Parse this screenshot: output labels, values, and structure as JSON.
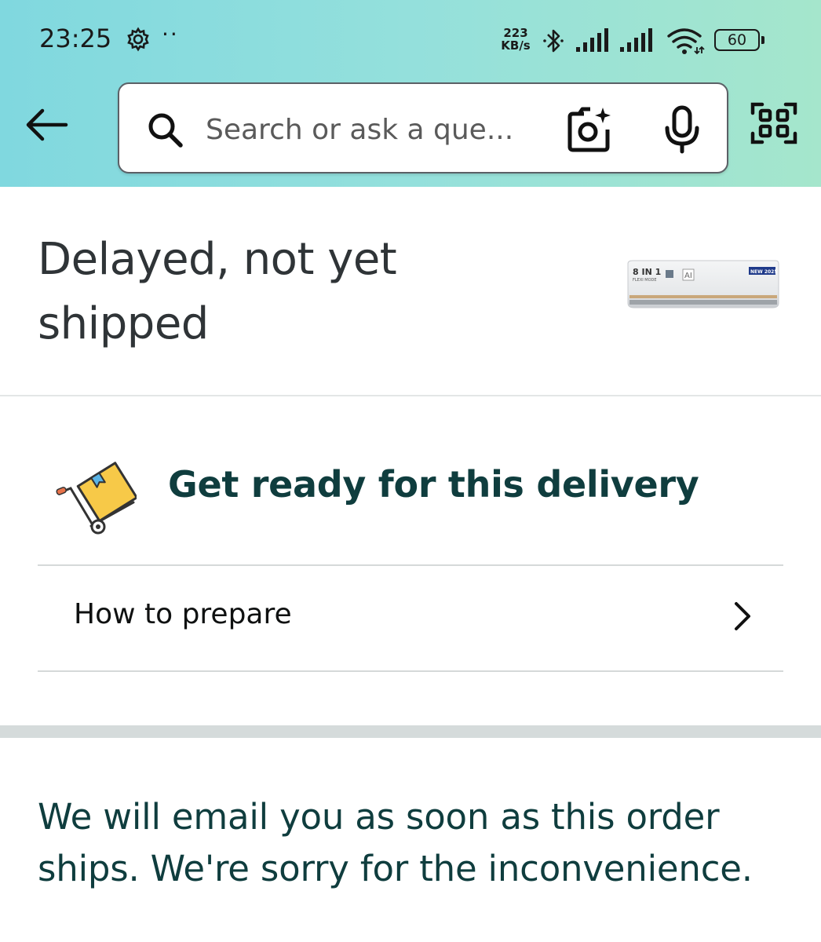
{
  "status_bar": {
    "time": "23:25",
    "dots": "··",
    "net_speed_value": "223",
    "net_speed_unit": "KB/s",
    "battery": "60"
  },
  "search": {
    "placeholder": "Search or ask a que..."
  },
  "order": {
    "status_title": "Delayed, not yet shipped",
    "product_image_text": [
      "8 IN 1",
      "FLEXI MODE",
      "AI",
      "NEW 2025"
    ]
  },
  "delivery": {
    "heading": "Get ready for this delivery",
    "prepare_label": "How to prepare"
  },
  "message": {
    "text": "We will email you as soon as this order ships. We're sorry for the inconvenience."
  },
  "colors": {
    "header_gradient_start": "#80d8df",
    "header_gradient_end": "#a5e6cc",
    "heading_teal": "#0f3d3e",
    "box_yellow": "#f7c948",
    "tag_blue": "#5ab4e6"
  },
  "icons": [
    "gear-icon",
    "bluetooth-icon",
    "signal-icon",
    "wifi-icon",
    "battery-icon",
    "back-arrow-icon",
    "search-icon",
    "camera-icon",
    "mic-icon",
    "qr-scan-icon",
    "hand-truck-box-icon",
    "chevron-right-icon"
  ]
}
